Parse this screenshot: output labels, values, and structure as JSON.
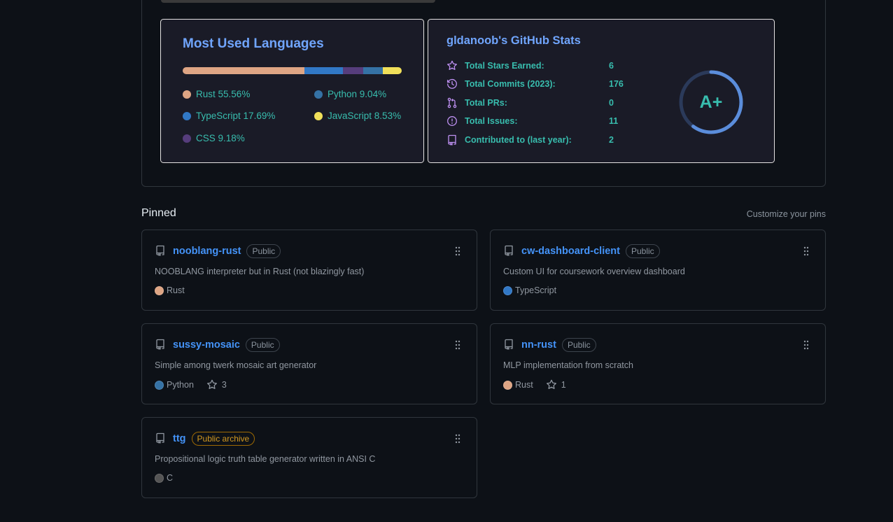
{
  "languages_card": {
    "title": "Most Used Languages",
    "languages": [
      {
        "name": "Rust",
        "percent": "55.56%",
        "fraction": 0.5556,
        "color": "#dea584"
      },
      {
        "name": "TypeScript",
        "percent": "17.69%",
        "fraction": 0.1769,
        "color": "#3178c6"
      },
      {
        "name": "CSS",
        "percent": "9.18%",
        "fraction": 0.0918,
        "color": "#563d7c"
      },
      {
        "name": "Python",
        "percent": "9.04%",
        "fraction": 0.0904,
        "color": "#3572A5"
      },
      {
        "name": "JavaScript",
        "percent": "8.53%",
        "fraction": 0.0853,
        "color": "#f1e05a"
      }
    ]
  },
  "stats_card": {
    "title": "gldanoob's GitHub Stats",
    "stats": [
      {
        "label": "Total Stars Earned:",
        "value": "6",
        "icon": "star-icon"
      },
      {
        "label": "Total Commits (2023):",
        "value": "176",
        "icon": "history-icon"
      },
      {
        "label": "Total PRs:",
        "value": "0",
        "icon": "pull-request-icon"
      },
      {
        "label": "Total Issues:",
        "value": "11",
        "icon": "issue-icon"
      },
      {
        "label": "Contributed to (last year):",
        "value": "2",
        "icon": "repo-icon"
      }
    ],
    "rank": "A+",
    "rank_progress": 0.6
  },
  "pinned": {
    "heading": "Pinned",
    "customize": "Customize your pins",
    "repos": [
      {
        "name": "nooblang-rust",
        "badge": "Public",
        "description": "NOOBLANG interpreter but in Rust (not blazingly fast)",
        "language": "Rust",
        "language_color": "#dea584",
        "stars": ""
      },
      {
        "name": "cw-dashboard-client",
        "badge": "Public",
        "description": "Custom UI for coursework overview dashboard",
        "language": "TypeScript",
        "language_color": "#3178c6",
        "stars": ""
      },
      {
        "name": "sussy-mosaic",
        "badge": "Public",
        "description": "Simple among twerk mosaic art generator",
        "language": "Python",
        "language_color": "#3572A5",
        "stars": "3"
      },
      {
        "name": "nn-rust",
        "badge": "Public",
        "description": "MLP implementation from scratch",
        "language": "Rust",
        "language_color": "#dea584",
        "stars": "1"
      },
      {
        "name": "ttg",
        "badge": "Public archive",
        "description": "Propositional logic truth table generator written in ANSI C",
        "language": "C",
        "language_color": "#555555",
        "stars": ""
      }
    ]
  },
  "colors": {
    "background": "#0d1117",
    "card_background": "#1a1b27",
    "title_blue": "#70a5fd",
    "text_teal": "#38bdae",
    "icon_purple": "#bf91f3",
    "link_blue": "#4493f8"
  }
}
